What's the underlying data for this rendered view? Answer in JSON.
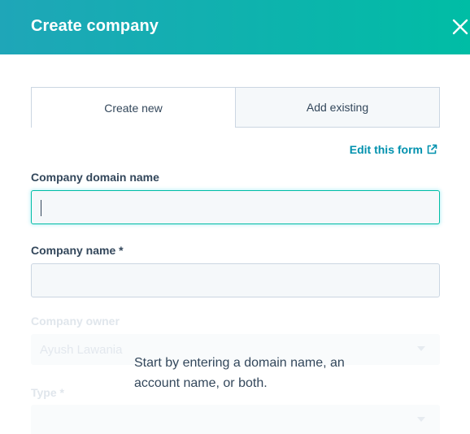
{
  "header": {
    "title": "Create company",
    "close_icon": "close-icon"
  },
  "tabs": [
    {
      "label": "Create new",
      "active": true
    },
    {
      "label": "Add existing",
      "active": false
    }
  ],
  "edit_form_link": {
    "label": "Edit this form",
    "icon": "external-link-icon"
  },
  "fields": {
    "domain": {
      "label": "Company domain name",
      "value": ""
    },
    "name": {
      "label": "Company name *",
      "value": ""
    },
    "owner": {
      "label": "Company owner",
      "value": "Ayush Lawania"
    },
    "type": {
      "label": "Type *",
      "value": ""
    }
  },
  "hint": "Start by entering a domain name, an account name, or both.",
  "colors": {
    "header_start": "#1fa6b8",
    "header_end": "#00bda5",
    "link": "#0091ae",
    "text": "#33475b"
  }
}
